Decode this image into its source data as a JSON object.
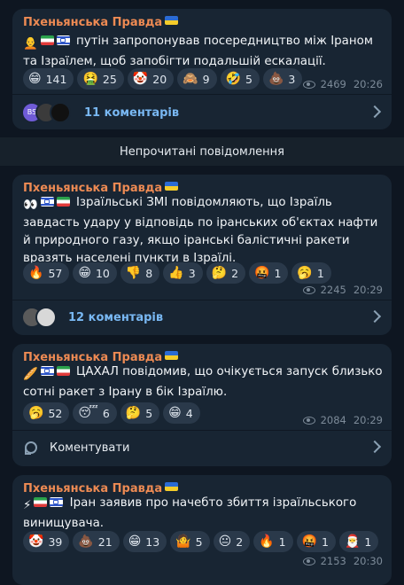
{
  "posts": [
    {
      "channel": "Пхеньянська Правда",
      "text": "путін запропонував посередництво між Іраном та Ізраїлем, щоб запобігти подальшій ескалації.",
      "reactions": [
        {
          "emoji": "😁",
          "count": "141"
        },
        {
          "emoji": "🤮",
          "count": "25"
        },
        {
          "emoji": "🤡",
          "count": "20"
        },
        {
          "emoji": "🙈",
          "count": "9"
        },
        {
          "emoji": "🤣",
          "count": "5"
        },
        {
          "emoji": "💩",
          "count": "3"
        }
      ],
      "views": "2469",
      "time": "20:26",
      "comments": "11 коментарів",
      "avatar_initials": "BS"
    },
    {
      "channel": "Пхеньянська Правда",
      "text": "Ізраїльські ЗМІ повідомляють, що Ізраїль завдасть удару у відповідь по іранських об'єктах нафти й природного газу, якщо іранські балістичні ракети вразять населені пункти в Ізраїлі.",
      "reactions": [
        {
          "emoji": "🔥",
          "count": "57"
        },
        {
          "emoji": "😁",
          "count": "10"
        },
        {
          "emoji": "👎",
          "count": "8"
        },
        {
          "emoji": "👍",
          "count": "3"
        },
        {
          "emoji": "🤔",
          "count": "2"
        },
        {
          "emoji": "🤬",
          "count": "1"
        },
        {
          "emoji": "🥱",
          "count": "1"
        }
      ],
      "views": "2245",
      "time": "20:29",
      "comments": "12 коментарів"
    },
    {
      "channel": "Пхеньянська Правда",
      "text": "ЦАХАЛ повідомив, що очікується запуск близько сотні ракет з Ірану в бік Ізраїлю.",
      "reactions": [
        {
          "emoji": "🥱",
          "count": "52"
        },
        {
          "emoji": "😴",
          "count": "6"
        },
        {
          "emoji": "🤔",
          "count": "5"
        },
        {
          "emoji": "😁",
          "count": "4"
        }
      ],
      "views": "2084",
      "time": "20:29",
      "comment_action": "Коментувати"
    },
    {
      "channel": "Пхеньянська Правда",
      "text": "Іран заявив про начебто збиття ізраїльського винищувача.",
      "reactions": [
        {
          "emoji": "🤡",
          "count": "39"
        },
        {
          "emoji": "💩",
          "count": "21"
        },
        {
          "emoji": "😁",
          "count": "13"
        },
        {
          "emoji": "🤷",
          "count": "5"
        },
        {
          "emoji": "😐",
          "count": "2"
        },
        {
          "emoji": "🔥",
          "count": "1"
        },
        {
          "emoji": "🤬",
          "count": "1"
        },
        {
          "emoji": "🎅",
          "count": "1"
        }
      ],
      "views": "2153",
      "time": "20:30"
    }
  ],
  "unread_label": "Непрочитані повідомлення",
  "prefix_emojis": {
    "post1": "🧑‍🦲",
    "post2": "👀",
    "post3": "🥖",
    "post4": "⚡"
  },
  "colors": {
    "background": "#0e1621",
    "card": "#182533",
    "channel_name": "#ed8a53",
    "link": "#79b8f3",
    "reaction_bg": "#2a394a"
  }
}
